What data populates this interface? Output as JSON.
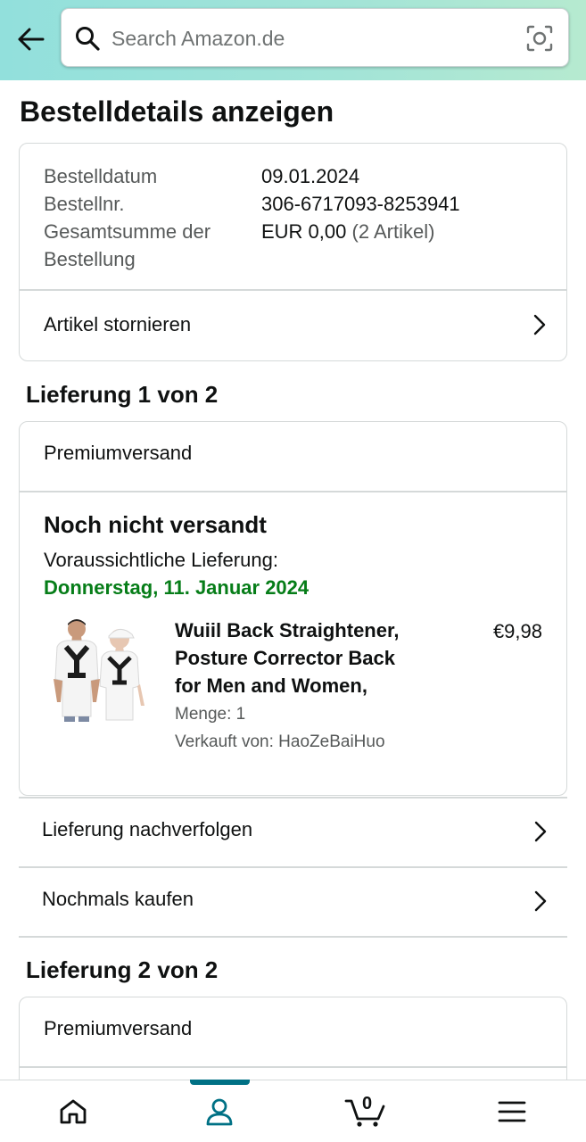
{
  "search": {
    "placeholder": "Search Amazon.de"
  },
  "page_title": "Bestelldetails anzeigen",
  "summary": {
    "date_label": "Bestelldatum",
    "date_value": "09.01.2024",
    "order_no_label": "Bestellnr.",
    "order_no_value": "306-6717093-8253941",
    "total_label_line1": "Gesamtsumme der",
    "total_label_line2": "Bestellung",
    "total_value": "EUR 0,00",
    "total_items": "(2 Artikel)",
    "cancel_label": "Artikel stornieren"
  },
  "delivery1": {
    "title": "Lieferung 1 von 2",
    "shipping_type": "Premiumversand",
    "status": "Noch nicht versandt",
    "expected_label": "Voraussichtliche Lieferung:",
    "expected_date": "Donnerstag, 11. Januar 2024",
    "product": {
      "title_line1": "Wuiil Back Straightener,",
      "title_line2": "Posture Corrector Back",
      "title_line3": "for Men and Women,",
      "price": "€9,98",
      "quantity": "Menge: 1",
      "seller": "Verkauft von: HaoZeBaiHuo"
    },
    "track_label": "Lieferung nachverfolgen",
    "buy_again_label": "Nochmals kaufen"
  },
  "delivery2": {
    "title": "Lieferung 2 von 2",
    "shipping_type": "Premiumversand"
  },
  "bottom_nav": {
    "cart_count": "0"
  },
  "colors": {
    "accent": "#007185",
    "delivery_green": "#067d18",
    "header_teal": "#92e0dc"
  }
}
